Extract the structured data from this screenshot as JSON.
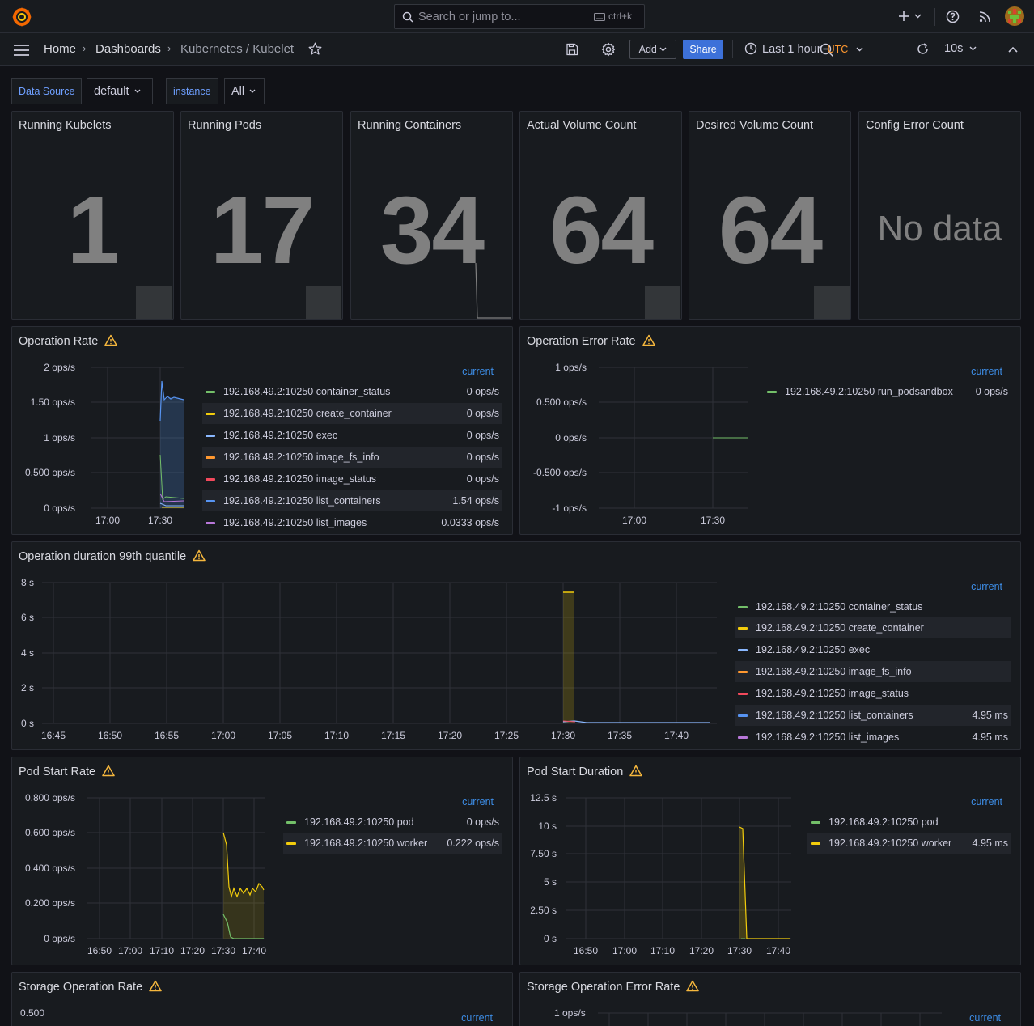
{
  "topbar": {
    "search_placeholder": "Search or jump to...",
    "shortcut": "ctrl+k"
  },
  "breadcrumb": {
    "home": "Home",
    "dashboards": "Dashboards",
    "current": "Kubernetes / Kubelet"
  },
  "toolbar": {
    "add_label": "Add",
    "share_label": "Share",
    "time_range": "Last 1 hour",
    "timezone": "UTC",
    "refresh_interval": "10s"
  },
  "variables": {
    "datasource_label": "Data Source",
    "datasource_value": "default",
    "instance_label": "instance",
    "instance_value": "All"
  },
  "colors": {
    "accent": "#3d71d9",
    "green": "#73bf69",
    "yellow": "#f2cc0c",
    "cyan": "#8ab8ff",
    "orange": "#ff9830",
    "red": "#f2495c",
    "blue": "#5794f2",
    "purple": "#b877d9",
    "warning": "#f5b73d"
  },
  "stats": [
    {
      "title": "Running Kubelets",
      "value": "1"
    },
    {
      "title": "Running Pods",
      "value": "17"
    },
    {
      "title": "Running Containers",
      "value": "34"
    },
    {
      "title": "Actual Volume Count",
      "value": "64"
    },
    {
      "title": "Desired Volume Count",
      "value": "64"
    },
    {
      "title": "Config Error Count",
      "value": "No data"
    }
  ],
  "legend_header": "current",
  "panels": {
    "op_rate": {
      "title": "Operation Rate",
      "y_ticks": [
        "2 ops/s",
        "1.50 ops/s",
        "1 ops/s",
        "0.500 ops/s",
        "0 ops/s"
      ],
      "x_ticks": [
        "17:00",
        "17:30"
      ],
      "legend": [
        {
          "name": "192.168.49.2:10250 container_status",
          "value": "0 ops/s",
          "color": "#73bf69"
        },
        {
          "name": "192.168.49.2:10250 create_container",
          "value": "0 ops/s",
          "color": "#f2cc0c"
        },
        {
          "name": "192.168.49.2:10250 exec",
          "value": "0 ops/s",
          "color": "#8ab8ff"
        },
        {
          "name": "192.168.49.2:10250 image_fs_info",
          "value": "0 ops/s",
          "color": "#ff9830"
        },
        {
          "name": "192.168.49.2:10250 image_status",
          "value": "0 ops/s",
          "color": "#f2495c"
        },
        {
          "name": "192.168.49.2:10250 list_containers",
          "value": "1.54 ops/s",
          "color": "#5794f2"
        },
        {
          "name": "192.168.49.2:10250 list_images",
          "value": "0.0333 ops/s",
          "color": "#b877d9"
        }
      ]
    },
    "op_error_rate": {
      "title": "Operation Error Rate",
      "y_ticks": [
        "1 ops/s",
        "0.500 ops/s",
        "0 ops/s",
        "-0.500 ops/s",
        "-1 ops/s"
      ],
      "x_ticks": [
        "17:00",
        "17:30"
      ],
      "legend": [
        {
          "name": "192.168.49.2:10250 run_podsandbox",
          "value": "0 ops/s",
          "color": "#73bf69"
        }
      ]
    },
    "op_duration": {
      "title": "Operation duration 99th quantile",
      "y_ticks": [
        "8 s",
        "6 s",
        "4 s",
        "2 s",
        "0 s"
      ],
      "x_ticks": [
        "16:45",
        "16:50",
        "16:55",
        "17:00",
        "17:05",
        "17:10",
        "17:15",
        "17:20",
        "17:25",
        "17:30",
        "17:35",
        "17:40"
      ],
      "legend": [
        {
          "name": "192.168.49.2:10250 container_status",
          "value": "",
          "color": "#73bf69"
        },
        {
          "name": "192.168.49.2:10250 create_container",
          "value": "",
          "color": "#f2cc0c"
        },
        {
          "name": "192.168.49.2:10250 exec",
          "value": "",
          "color": "#8ab8ff"
        },
        {
          "name": "192.168.49.2:10250 image_fs_info",
          "value": "",
          "color": "#ff9830"
        },
        {
          "name": "192.168.49.2:10250 image_status",
          "value": "",
          "color": "#f2495c"
        },
        {
          "name": "192.168.49.2:10250 list_containers",
          "value": "4.95 ms",
          "color": "#5794f2"
        },
        {
          "name": "192.168.49.2:10250 list_images",
          "value": "4.95 ms",
          "color": "#b877d9"
        }
      ]
    },
    "pod_start_rate": {
      "title": "Pod Start Rate",
      "y_ticks": [
        "0.800 ops/s",
        "0.600 ops/s",
        "0.400 ops/s",
        "0.200 ops/s",
        "0 ops/s"
      ],
      "x_ticks": [
        "16:50",
        "17:00",
        "17:10",
        "17:20",
        "17:30",
        "17:40"
      ],
      "legend": [
        {
          "name": "192.168.49.2:10250 pod",
          "value": "0 ops/s",
          "color": "#73bf69"
        },
        {
          "name": "192.168.49.2:10250 worker",
          "value": "0.222 ops/s",
          "color": "#f2cc0c"
        }
      ]
    },
    "pod_start_duration": {
      "title": "Pod Start Duration",
      "y_ticks": [
        "12.5 s",
        "10 s",
        "7.50 s",
        "5 s",
        "2.50 s",
        "0 s"
      ],
      "x_ticks": [
        "16:50",
        "17:00",
        "17:10",
        "17:20",
        "17:30",
        "17:40"
      ],
      "legend": [
        {
          "name": "192.168.49.2:10250 pod",
          "value": "",
          "color": "#73bf69"
        },
        {
          "name": "192.168.49.2:10250 worker",
          "value": "4.95 ms",
          "color": "#f2cc0c"
        }
      ]
    },
    "storage_op_rate": {
      "title": "Storage Operation Rate",
      "y_ticks": [
        "0.500"
      ]
    },
    "storage_op_error_rate": {
      "title": "Storage Operation Error Rate",
      "y_ticks": [
        "1 ops/s"
      ]
    }
  }
}
